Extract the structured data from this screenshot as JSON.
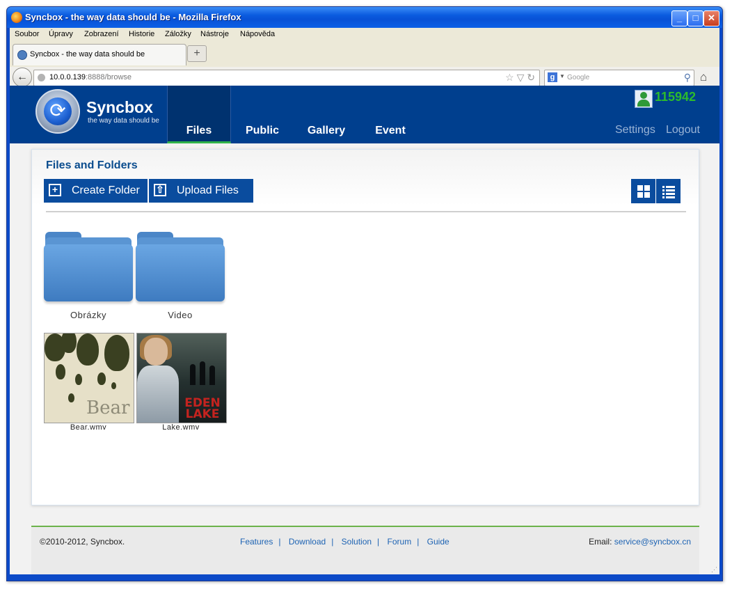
{
  "window": {
    "title": "Syncbox - the way data should be - Mozilla Firefox",
    "buttons": {
      "minimize": "_",
      "maximize": "□",
      "close": "✕"
    }
  },
  "menu": [
    "Soubor",
    "Úpravy",
    "Zobrazení",
    "Historie",
    "Záložky",
    "Nástroje",
    "Nápověda"
  ],
  "tab": {
    "title": "Syncbox - the way data should be",
    "new_tab": "+"
  },
  "navbar": {
    "back": "←",
    "url_host": "10.0.0.139",
    "url_rest": ":8888/browse",
    "url_icons": "☆ ▽ ↻",
    "search_placeholder": "Google",
    "search_engine": "g",
    "home": "⌂"
  },
  "app": {
    "logo_name": "Syncbox",
    "logo_tagline": "the way data should be",
    "logo_icon": "⟳",
    "nav": [
      "Files",
      "Public",
      "Gallery",
      "Event"
    ],
    "active_nav": "Files",
    "user_id": "115942",
    "settings": "Settings",
    "logout": "Logout"
  },
  "content": {
    "title": "Files and Folders",
    "create_folder": "Create Folder",
    "upload_files": "Upload Files",
    "create_icon": "+",
    "upload_icon": "⇧",
    "folders": [
      {
        "name": "Obrázky"
      },
      {
        "name": "Video"
      }
    ],
    "files": [
      {
        "name": "Bear.wmv",
        "thumb_text": "Bear"
      },
      {
        "name": "Lake.wmv",
        "thumb_text": "EDEN LAKE"
      }
    ]
  },
  "footer": {
    "copyright": "©2010-2012, Syncbox.",
    "links": [
      "Features",
      "Download",
      "Solution",
      "Forum",
      "Guide"
    ],
    "email_label": "Email:",
    "email": "service@syncbox.cn"
  },
  "colors": {
    "header_bg": "#003f8e",
    "active_underline": "#2fb34b",
    "button_bg": "#0a4c9e",
    "user_id": "#2cbb2c",
    "link": "#1d63b3"
  }
}
